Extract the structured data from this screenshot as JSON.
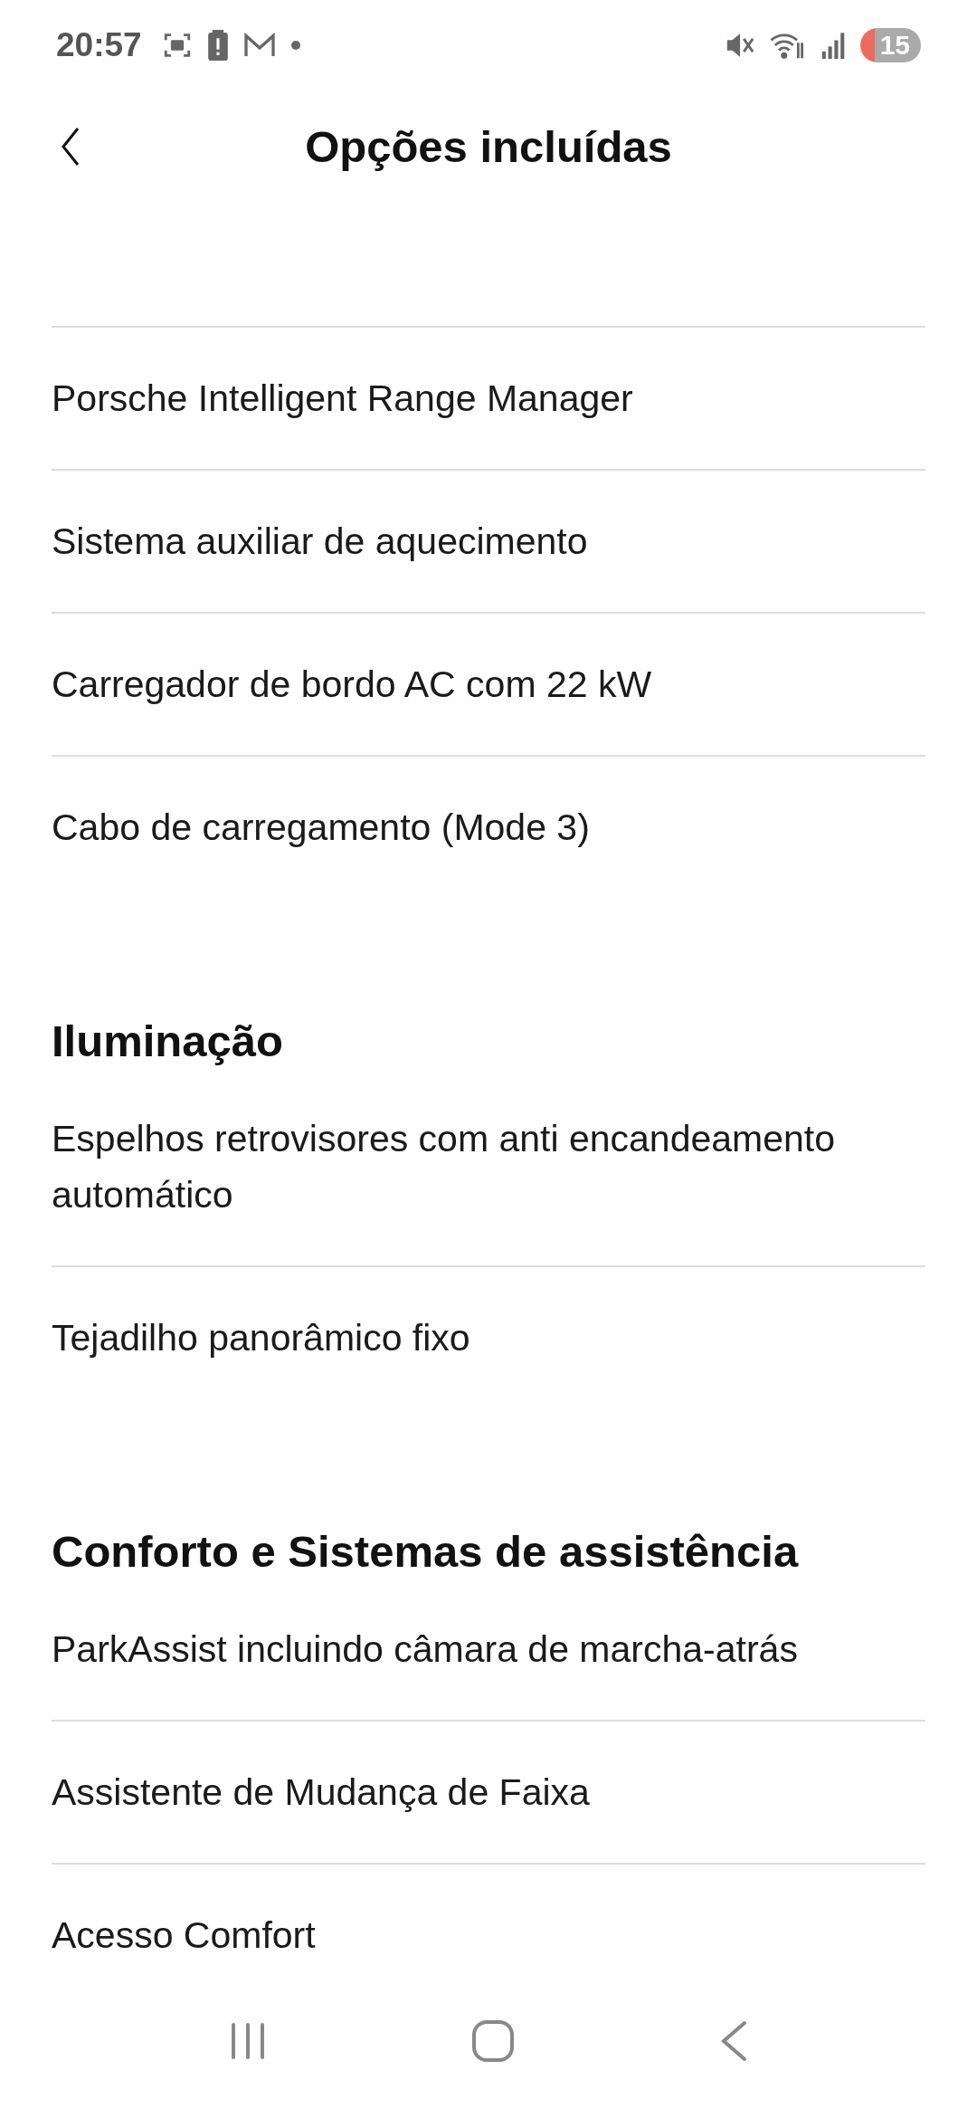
{
  "status_bar": {
    "time": "20:57",
    "battery": "15"
  },
  "header": {
    "title": "Opções incluídas"
  },
  "sections": [
    {
      "items": [
        "Porsche Intelligent Range Manager",
        "Sistema auxiliar de aquecimento",
        "Carregador de bordo AC com 22 kW",
        "Cabo de carregamento (Mode 3)"
      ]
    },
    {
      "title": "Iluminação",
      "items": [
        "Espelhos retrovisores com anti encandeamento automático",
        "Tejadilho panorâmico fixo"
      ]
    },
    {
      "title": "Conforto e Sistemas de assistência",
      "items": [
        "ParkAssist incluindo câmara de marcha-atrás",
        "Assistente de Mudança de Faixa",
        "Acesso Comfort"
      ]
    }
  ]
}
